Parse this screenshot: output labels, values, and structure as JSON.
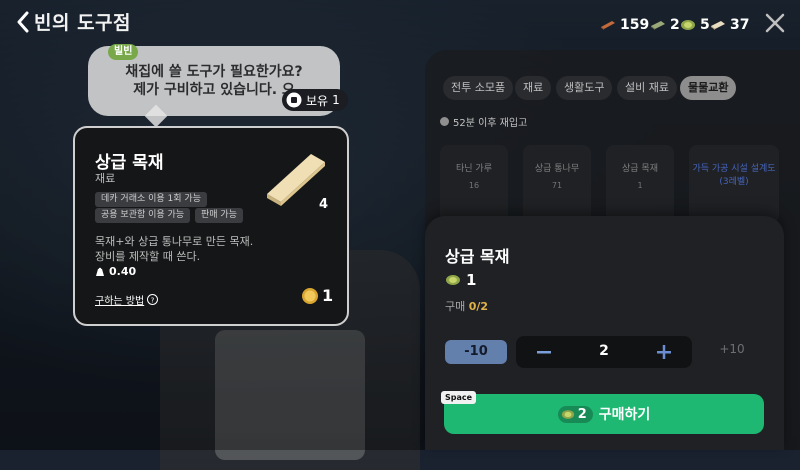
{
  "window": {
    "title": "빈의 도구점"
  },
  "currencies": [
    {
      "icon": "wood-plank-icon",
      "value": "159"
    },
    {
      "icon": "bill-icon",
      "value": "2"
    },
    {
      "icon": "bug-coin-icon",
      "value": "5"
    },
    {
      "icon": "bar-icon",
      "value": "37"
    }
  ],
  "npc": {
    "name": "빌빈",
    "line1": "채집에 쓸 도구가 필요한가요?",
    "line2": "제가 구비하고 있습니다. 으",
    "owned_label": "보유",
    "owned_count": "1"
  },
  "item": {
    "name": "상급 목재",
    "category": "재료",
    "tags": [
      "데카 거래소 이용 1회 가능",
      "공용 보관함 이용 가능",
      "판매 가능"
    ],
    "quantity": "4",
    "desc_line1": "목재+와 상급 통나무로 만든 목재.",
    "desc_line2": "장비를 제작할 때 쓴다.",
    "weight": "0.40",
    "howto_label": "구하는 방법",
    "price": "1"
  },
  "tabs": [
    {
      "label": "전투 소모품",
      "active": false
    },
    {
      "label": "재료",
      "active": false
    },
    {
      "label": "생활도구",
      "active": false
    },
    {
      "label": "설비 재료",
      "active": false
    },
    {
      "label": "물물교환",
      "active": true
    }
  ],
  "restock": {
    "text": "52분 이후 재입고"
  },
  "grid_items": [
    {
      "name": "타닌 가루",
      "count": "16"
    },
    {
      "name": "상급 통나무",
      "count": "71"
    },
    {
      "name": "상급 목재",
      "count": "1"
    },
    {
      "name": "가득 가공 시설 설계도(3레벨)",
      "count": ""
    }
  ],
  "purchase": {
    "title": "상급 목재",
    "unit_price": "1",
    "limit_label": "구매",
    "limit_value": "0/2",
    "minus10_label": "-10",
    "quantity": "2",
    "plus10_label": "+10",
    "key_hint": "Space",
    "total_cost": "2",
    "buy_label": "구매하기"
  },
  "colors": {
    "accent_green": "#1fb873",
    "tab_active": "#8d8d8d",
    "limit_gold": "#e0b34a",
    "stepper_blue": "#7a9fd8"
  }
}
